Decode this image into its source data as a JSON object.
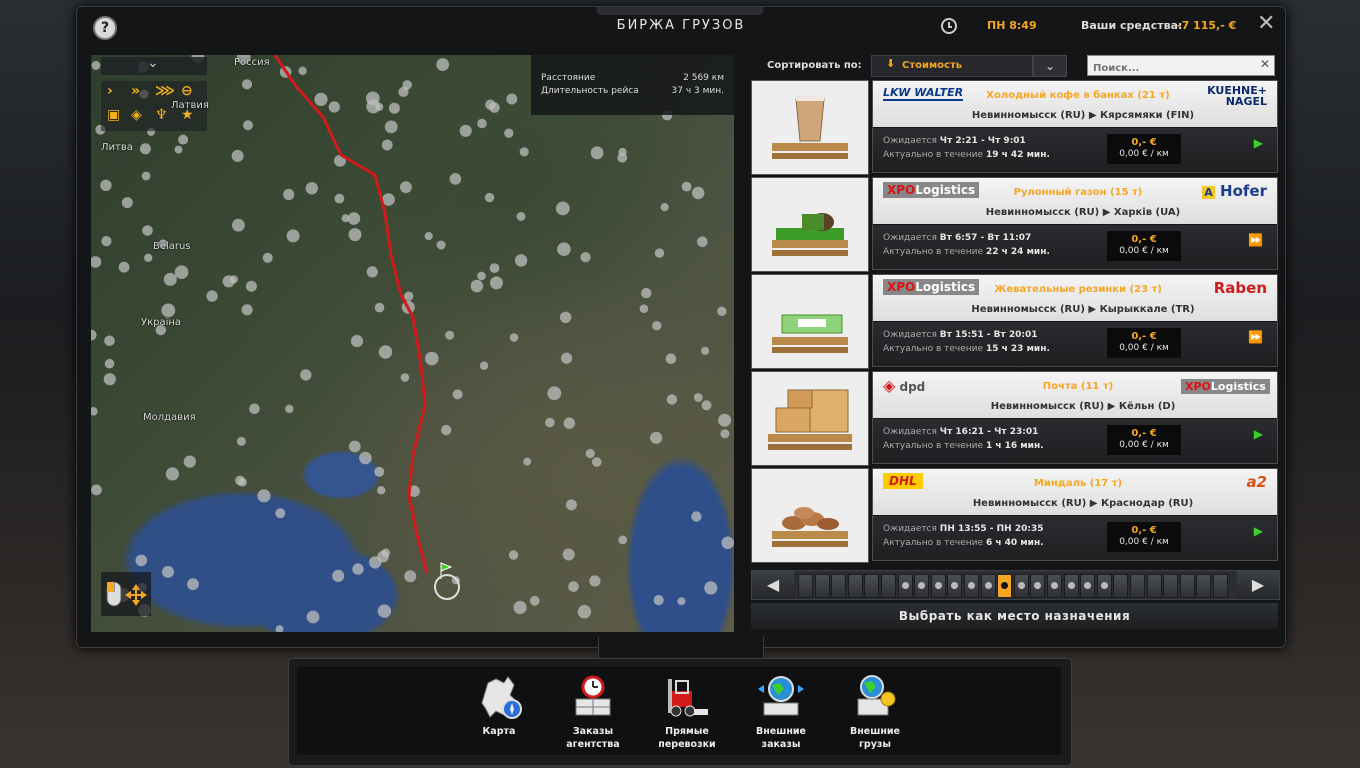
{
  "window": {
    "title": "БИРЖА ГРУЗОВ",
    "time": "ПН 8:49",
    "funds_label": "Ваши средства:",
    "funds_value": "-7 115,- €"
  },
  "map": {
    "info": {
      "distance_label": "Расстояние",
      "distance_value": "2 569 км",
      "duration_label": "Длительность рейса",
      "duration_value": "37 ч 3 мин."
    },
    "labels": [
      "Россия",
      "Литва",
      "Латвия",
      "Belarus",
      "Україна",
      "Молдавия"
    ],
    "filter_icons": [
      "chevron-icon",
      "double-chevron-icon",
      "triple-chevron-icon",
      "trailer-icon",
      "cargo-icon",
      "hazard-icon",
      "trophy-icon",
      "star-icon"
    ]
  },
  "sort": {
    "label": "Сортировать по:",
    "selected": "Стоимость",
    "search_placeholder": "Поиск..."
  },
  "jobs": [
    {
      "company": "LKW WALTER",
      "cargo": "Холодный кофе в банках (21 т)",
      "recipient": "KUEHNE+NAGEL",
      "from": "Невинномысск (RU)",
      "to": "Кярсямяки (FIN)",
      "expected_label": "Ожидается",
      "expected": "Чт 2:21 - Чт 9:01",
      "valid_label": "Актуально в течение",
      "valid": "19 ч 42 мин.",
      "price": "0,- €",
      "per_km": "0,00 € / км",
      "arrow": "green"
    },
    {
      "company": "XPO Logistics",
      "cargo": "Рулонный газон (15 т)",
      "recipient": "Hofer",
      "from": "Невинномысск (RU)",
      "to": "Харків (UA)",
      "expected_label": "Ожидается",
      "expected": "Вт 6:57 - Вт 11:07",
      "valid_label": "Актуально в течение",
      "valid": "22 ч 24 мин.",
      "price": "0,- €",
      "per_km": "0,00 € / км",
      "arrow": "blue"
    },
    {
      "company": "XPO Logistics",
      "cargo": "Жевательные резинки (23 т)",
      "recipient": "Raben",
      "from": "Невинномысск (RU)",
      "to": "Кырыккале (TR)",
      "expected_label": "Ожидается",
      "expected": "Вт 15:51 - Вт 20:01",
      "valid_label": "Актуально в течение",
      "valid": "15 ч 23 мин.",
      "price": "0,- €",
      "per_km": "0,00 € / км",
      "arrow": "blue"
    },
    {
      "company": "dpd",
      "cargo": "Почта (11 т)",
      "recipient": "XPO Logistics",
      "from": "Невинномысск (RU)",
      "to": "Кёльн (D)",
      "expected_label": "Ожидается",
      "expected": "Чт 16:21 - Чт 23:01",
      "valid_label": "Актуально в течение",
      "valid": "1 ч 16 мин.",
      "price": "0,- €",
      "per_km": "0,00 € / км",
      "arrow": "green"
    },
    {
      "company": "DHL",
      "cargo": "Миндаль (17 т)",
      "recipient": "a2",
      "from": "Невинномысск (RU)",
      "to": "Краснодар (RU)",
      "expected_label": "Ожидается",
      "expected": "ПН 13:55 - ПН 20:35",
      "valid_label": "Актуально в течение",
      "valid": "6 ч 40 мин.",
      "price": "0,- €",
      "per_km": "0,00 € / км",
      "arrow": "green"
    }
  ],
  "pager": {
    "pages": 26,
    "current": 12
  },
  "select_destination": "Выбрать как место назначения",
  "dock": [
    {
      "label": "Карта"
    },
    {
      "label": "Заказы агентства"
    },
    {
      "label": "Прямые перевозки"
    },
    {
      "label": "Внешние заказы"
    },
    {
      "label": "Внешние грузы"
    }
  ],
  "colors": {
    "accent": "#f5a623",
    "route": "#d11a1a",
    "play_green": "#3cd12a",
    "play_blue": "#3aa7ff"
  }
}
